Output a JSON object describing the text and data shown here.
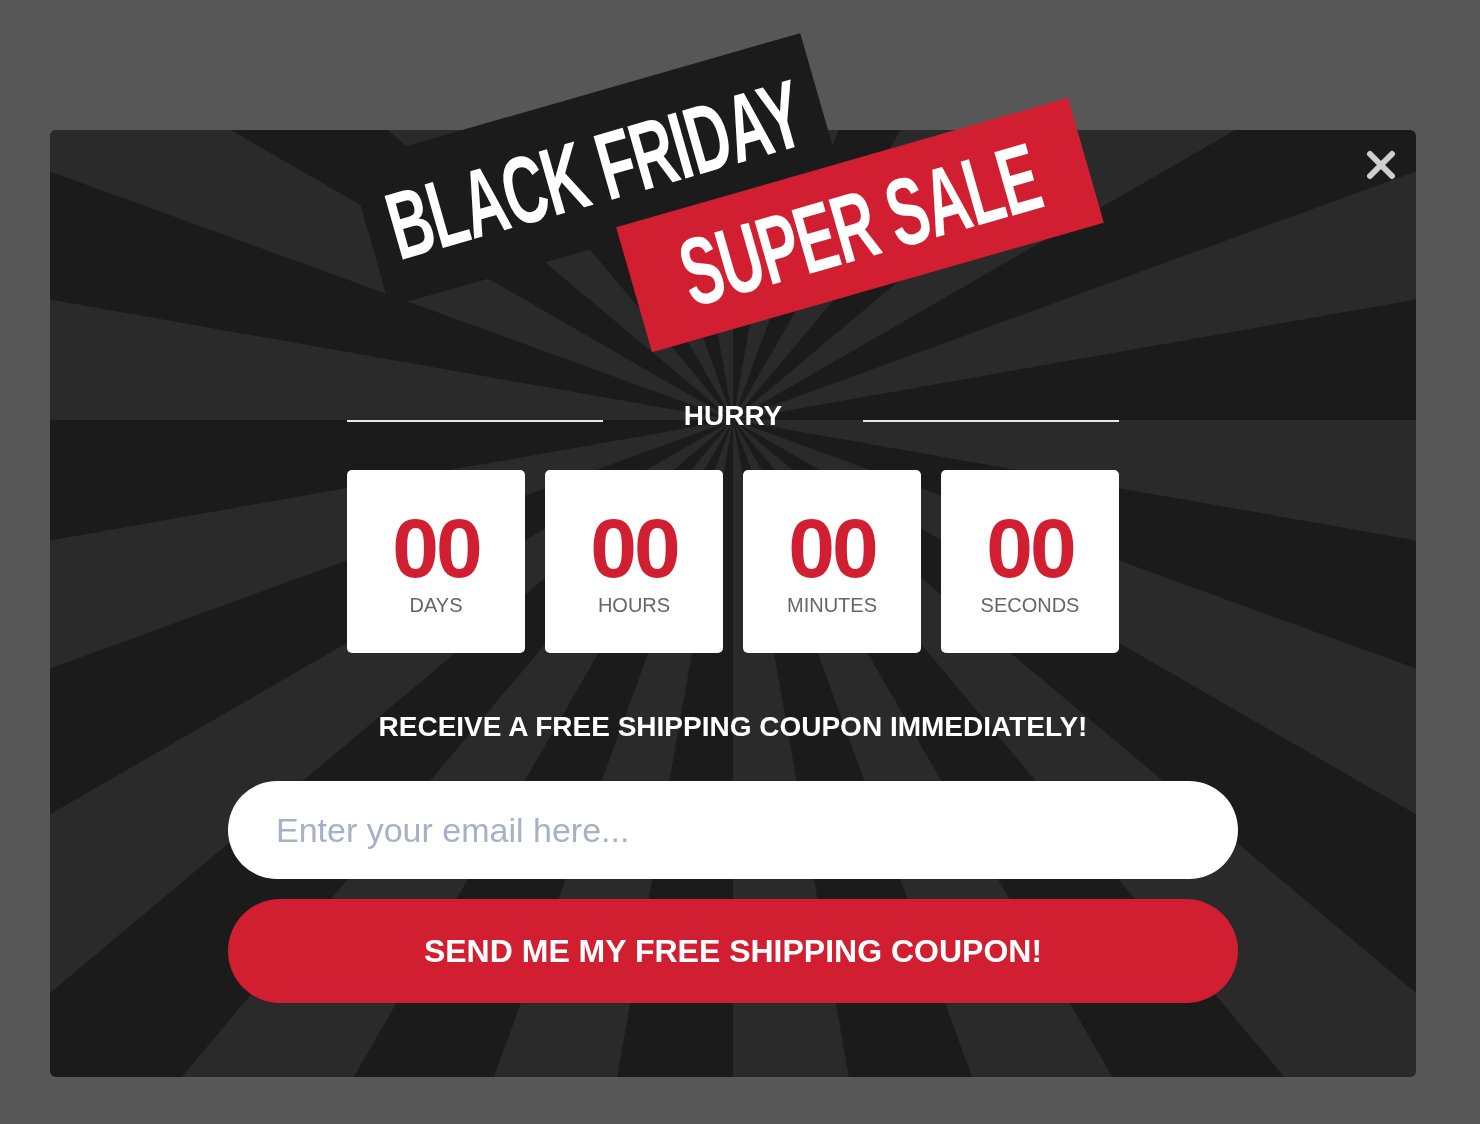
{
  "banner": {
    "line_1": "BLACK FRIDAY",
    "line_2": "SUPER SALE"
  },
  "heading": "HURRY",
  "countdown": [
    {
      "value": "00",
      "unit": "DAYS"
    },
    {
      "value": "00",
      "unit": "HOURS"
    },
    {
      "value": "00",
      "unit": "MINUTES"
    },
    {
      "value": "00",
      "unit": "SECONDS"
    }
  ],
  "tagline": "RECEIVE A FREE SHIPPING COUPON IMMEDIATELY!",
  "email": {
    "placeholder": "Enter your email here..."
  },
  "submit_button": "SEND ME MY FREE SHIPPING COUPON!"
}
